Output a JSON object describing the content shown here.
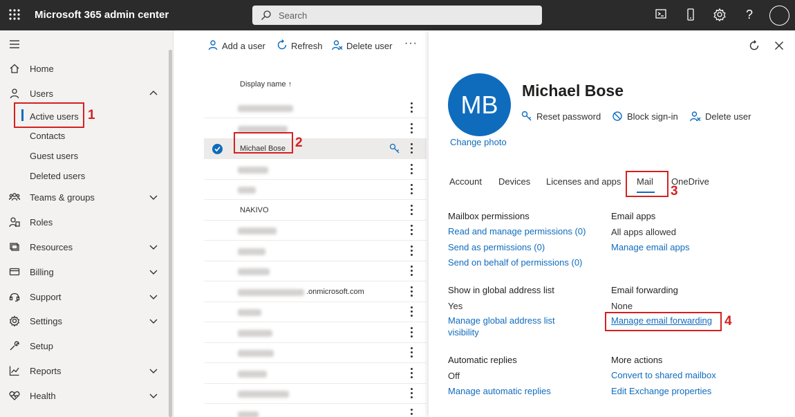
{
  "app": {
    "title": "Microsoft 365 admin center"
  },
  "search": {
    "placeholder": "Search"
  },
  "colors": {
    "accent": "#0f6cbd",
    "highlight": "#d52020",
    "topbar": "#2b2b2b"
  },
  "sidebar": {
    "items": [
      {
        "label": "Home",
        "icon": "home-icon"
      },
      {
        "label": "Users",
        "icon": "user-icon"
      },
      {
        "label": "Teams & groups",
        "icon": "teams-icon"
      },
      {
        "label": "Roles",
        "icon": "roles-icon"
      },
      {
        "label": "Resources",
        "icon": "resources-icon"
      },
      {
        "label": "Billing",
        "icon": "billing-icon"
      },
      {
        "label": "Support",
        "icon": "headset-icon"
      },
      {
        "label": "Settings",
        "icon": "gear-icon"
      },
      {
        "label": "Setup",
        "icon": "wrench-icon"
      },
      {
        "label": "Reports",
        "icon": "chart-icon"
      },
      {
        "label": "Health",
        "icon": "heart-icon"
      }
    ],
    "users_sub": [
      "Active users",
      "Contacts",
      "Guest users",
      "Deleted users"
    ]
  },
  "steps": [
    "1",
    "2",
    "3",
    "4"
  ],
  "list": {
    "toolbar": {
      "add": "Add a user",
      "refresh": "Refresh",
      "delete": "Delete user"
    },
    "column": "Display name",
    "rows": [
      {
        "name": "",
        "blur": 80
      },
      {
        "name": "",
        "blur": 72
      },
      {
        "name": "Michael Bose",
        "blur": 0
      },
      {
        "name": "",
        "blur": 44
      },
      {
        "name": "",
        "blur": 26
      },
      {
        "name": "NAKIVO",
        "blur": 0
      },
      {
        "name": "",
        "blur": 56
      },
      {
        "name": "",
        "blur": 40
      },
      {
        "name": "",
        "blur": 46
      },
      {
        "name": ".onmicrosoft.com",
        "blur": 96
      },
      {
        "name": "",
        "blur": 34
      },
      {
        "name": "",
        "blur": 50
      },
      {
        "name": "",
        "blur": 52
      },
      {
        "name": "",
        "blur": 42
      },
      {
        "name": "",
        "blur": 74
      },
      {
        "name": "",
        "blur": 30
      }
    ]
  },
  "panel": {
    "initials": "MB",
    "change_photo": "Change photo",
    "name": "Michael Bose",
    "actions": {
      "reset": "Reset password",
      "block": "Block sign-in",
      "delete": "Delete user"
    },
    "tabs": [
      "Account",
      "Devices",
      "Licenses and apps",
      "Mail",
      "OneDrive"
    ],
    "mailbox_permissions": {
      "title": "Mailbox permissions",
      "links": [
        "Read and manage permissions (0)",
        "Send as permissions (0)",
        "Send on behalf of permissions (0)"
      ]
    },
    "email_apps": {
      "title": "Email apps",
      "value": "All apps allowed",
      "link": "Manage email apps"
    },
    "gal": {
      "title": "Show in global address list",
      "value": "Yes",
      "link1": "Manage global address list",
      "link2": "visibility"
    },
    "forwarding": {
      "title": "Email forwarding",
      "value": "None",
      "link": "Manage email forwarding"
    },
    "auto_replies": {
      "title": "Automatic replies",
      "value": "Off",
      "link": "Manage automatic replies"
    },
    "more_actions": {
      "title": "More actions",
      "link1": "Convert to shared mailbox",
      "link2": "Edit Exchange properties"
    }
  }
}
